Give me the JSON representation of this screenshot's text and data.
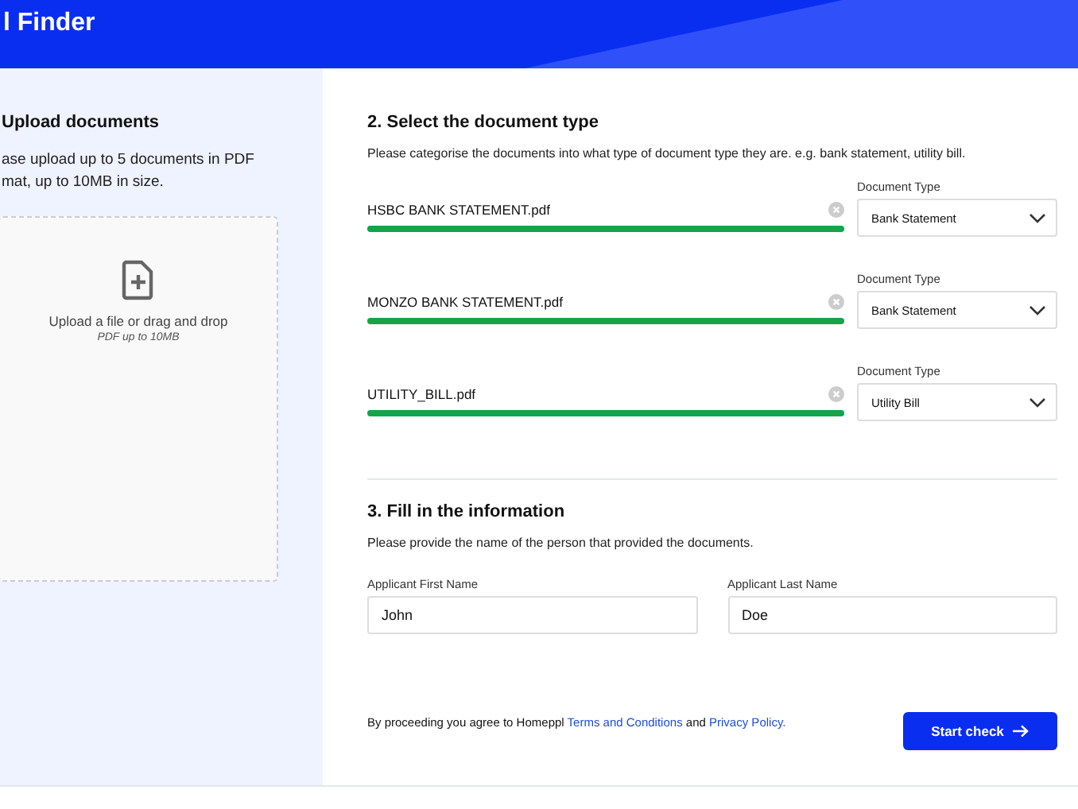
{
  "header": {
    "title": "l Finder"
  },
  "upload_panel": {
    "heading": "Upload documents",
    "description_lines": [
      "ase upload up to 5 documents in PDF",
      "mat, up to 10MB in size."
    ],
    "dropzone": {
      "prompt": "Upload a file or drag and drop",
      "hint": "PDF up to 10MB"
    }
  },
  "document_type_section": {
    "heading": "2. Select the document type",
    "description": "Please categorise the documents into what type of document type they are. e.g. bank statement, utility bill.",
    "files": [
      {
        "name": "HSBC BANK STATEMENT.pdf",
        "level": 1,
        "type_label": "Document Type",
        "type_value": "Bank Statement"
      },
      {
        "name": "MONZO BANK STATEMENT.pdf",
        "level": 1,
        "type_label": "Document Type",
        "type_value": "Bank Statement"
      },
      {
        "name": "UTILITY_BILL.pdf",
        "level": 1,
        "type_label": "Document Type",
        "type_value": "Utility Bill"
      }
    ]
  },
  "information_section": {
    "heading": "3. Fill in the information",
    "description": "Please provide the name of the person that provided the documents.",
    "fields": [
      {
        "label": "Applicant First Name",
        "value": "John"
      },
      {
        "label": "Applicant Last Name",
        "value": "Doe"
      }
    ]
  },
  "footer": {
    "agreement_text": "By proceeding you agree to Homeppl",
    "terms_link": "Terms and Conditions",
    "joiner": "and",
    "privacy_link": "Privacy Policy.",
    "button": "Start check"
  }
}
